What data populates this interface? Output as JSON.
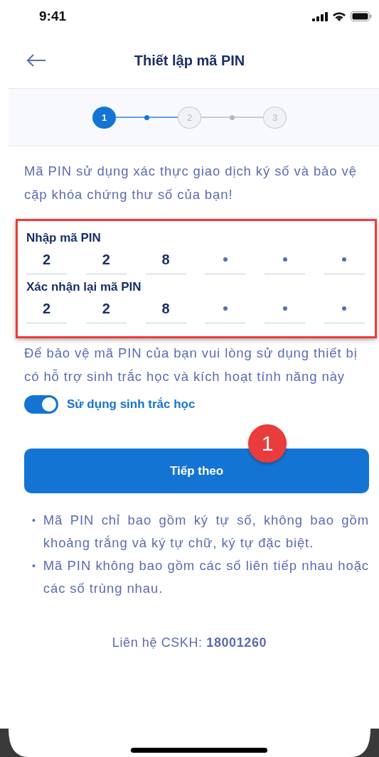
{
  "status_bar": {
    "time": "9:41"
  },
  "header": {
    "title": "Thiết lập mã PIN"
  },
  "steps": [
    {
      "label": "1",
      "current": true
    },
    {
      "label": "2",
      "current": false
    },
    {
      "label": "3",
      "current": false
    }
  ],
  "intro": "Mã PIN sử dụng xác thực giao dịch ký số và bảo vệ cặp khóa chứng thư số của bạn!",
  "pin_section": {
    "highlighted": true,
    "fields": [
      {
        "label": "Nhập mã PIN",
        "slots": [
          {
            "kind": "digit",
            "value": "2"
          },
          {
            "kind": "digit",
            "value": "2"
          },
          {
            "kind": "digit",
            "value": "8"
          },
          {
            "kind": "empty"
          },
          {
            "kind": "empty"
          },
          {
            "kind": "empty"
          }
        ]
      },
      {
        "label": "Xác nhận lại mã PIN",
        "slots": [
          {
            "kind": "digit",
            "value": "2"
          },
          {
            "kind": "digit",
            "value": "2"
          },
          {
            "kind": "digit",
            "value": "8"
          },
          {
            "kind": "empty"
          },
          {
            "kind": "empty"
          },
          {
            "kind": "empty"
          }
        ]
      }
    ]
  },
  "biometric_hint": "Để bảo vệ mã PIN của bạn vui lòng sử dụng thiết bị có hỗ trợ sinh trắc học và kích hoạt tính năng này",
  "biometric_toggle": {
    "label": "Sử dụng sinh trắc học",
    "on": true
  },
  "next_button": {
    "label": "Tiếp theo",
    "badge": "1"
  },
  "rules": [
    {
      "marker": "•",
      "text": "Mã PIN chỉ bao gồm ký tự số, không bao gồm khoảng trắng và ký tự chữ, ký tự đặc biệt."
    },
    {
      "marker": "•",
      "text": "Mã PIN không bao gồm các số liên tiếp nhau hoặc các số trùng nhau."
    }
  ],
  "contact": "Liên hệ CSKH: **18001260**"
}
